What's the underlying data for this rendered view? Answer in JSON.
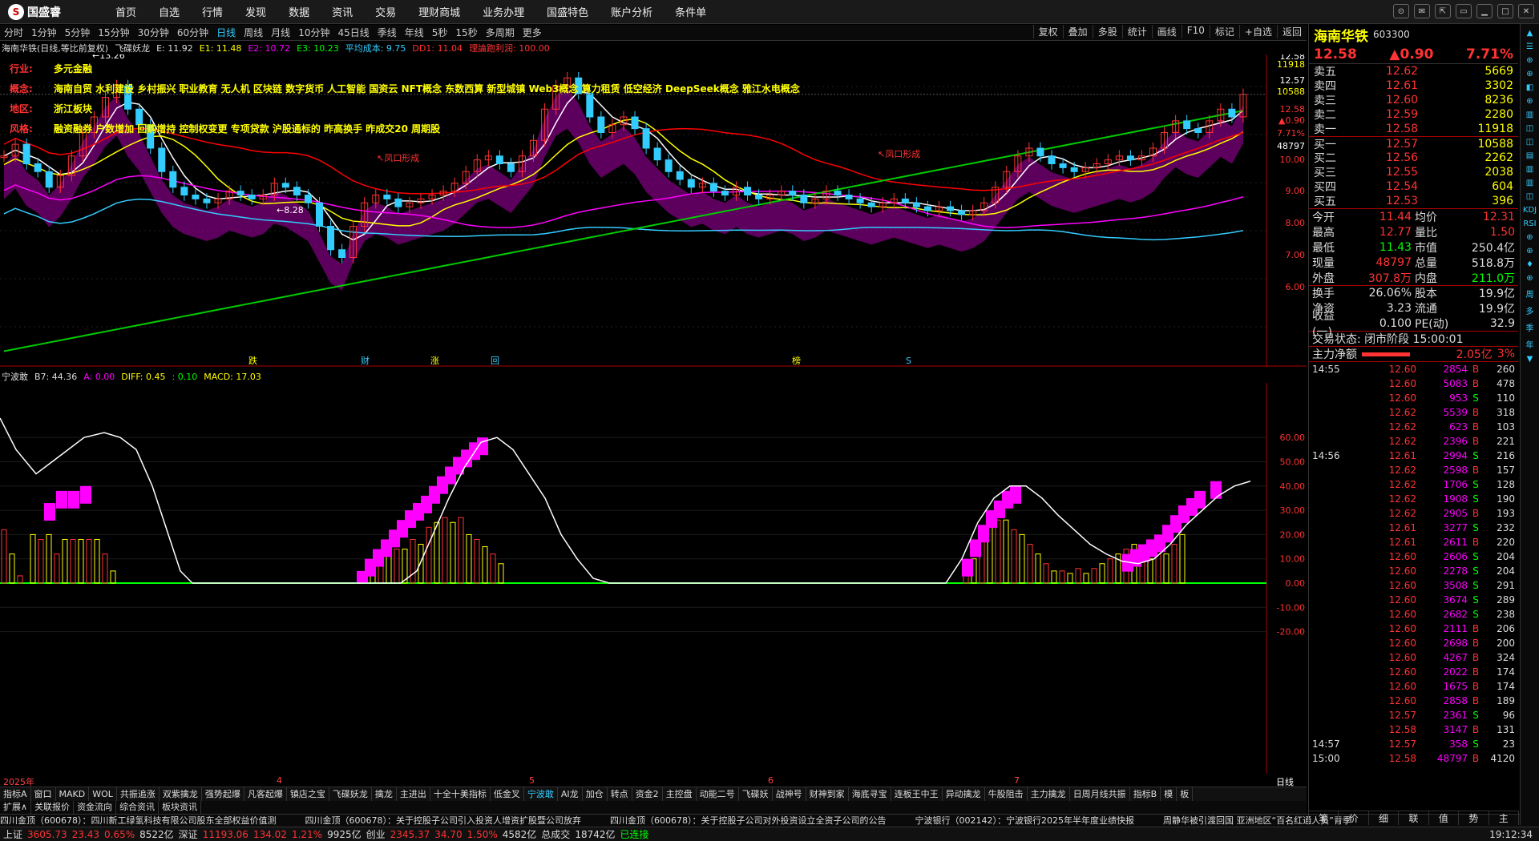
{
  "app": {
    "logo_text": "国盛睿",
    "logo_mark": "S"
  },
  "menu": [
    "首页",
    "自选",
    "行情",
    "发现",
    "数据",
    "资讯",
    "交易",
    "理财商城",
    "业务办理",
    "国盛特色",
    "账户分析",
    "条件单"
  ],
  "window_controls": [
    "⊙",
    "✉",
    "⇱",
    "▭",
    "▁",
    "□",
    "✕"
  ],
  "timeframes": [
    "分时",
    "1分钟",
    "5分钟",
    "15分钟",
    "30分钟",
    "60分钟",
    "日线",
    "周线",
    "月线",
    "10分钟",
    "45日线",
    "季线",
    "年线",
    "5秒",
    "15秒",
    "多周期",
    "更多"
  ],
  "timeframe_active": "日线",
  "tf_right": [
    "复权",
    "叠加",
    "多股",
    "统计",
    "画线",
    "F10",
    "标记",
    "+自选",
    "返回"
  ],
  "chart_header": {
    "title": "海南华铁(日线,等比前复权)",
    "indicator": "飞碟妖龙",
    "e": "E: 11.92",
    "e1": "E1: 11.48",
    "e2": "E2: 10.72",
    "e3": "E3: 10.23",
    "avg_cost": "平均成本: 9.75",
    "dd1": "DD1: 11.04",
    "profit": "理論跑利润: 100.00"
  },
  "info": {
    "industry_k": "行业:",
    "industry_v": "多元金融",
    "concept_k": "概念:",
    "concept_v": "海南自贸 水利建设 乡村振兴 职业教育 无人机 区块链 数字货币 人工智能 国资云 NFT概念 东数西算 新型城镇 Web3概念 算力租赁 低空经济 DeepSeek概念 雅江水电概念",
    "region_k": "地区:",
    "region_v": "浙江板块",
    "style_k": "风格:",
    "style_v": "融资融券 户数增加 回购增持 控制权变更 专项贷款 沪股通标的 昨高换手 昨成交20 周期股"
  },
  "annotations": {
    "high": "13.26",
    "low": "8.28",
    "wind1": "凤口形成",
    "wind2": "凤口形成",
    "price_line": "12.58"
  },
  "markers": [
    "跌",
    "财",
    "涨",
    "回",
    "榜",
    "S"
  ],
  "price_axis": [
    "12.58",
    "11918",
    "12.57",
    "10588",
    "12.58",
    "▲0.90",
    "7.71%",
    "48797",
    "10.00",
    "9.00",
    "8.00",
    "7.00",
    "6.00"
  ],
  "chart_data": [
    {
      "type": "candlestick",
      "title": "海南华铁(日线,等比前复权)",
      "y_ticks": [
        6.0,
        7.0,
        8.0,
        9.0,
        10.0,
        12.58
      ],
      "high": 13.26,
      "low": 8.28,
      "last": 12.58,
      "x_ticks": [
        "2025年",
        "4",
        "5",
        "6",
        "7"
      ],
      "closes": [
        11.0,
        11.3,
        10.8,
        10.6,
        10.2,
        10.5,
        11.0,
        11.6,
        12.0,
        12.5,
        12.8,
        12.2,
        11.8,
        11.2,
        10.6,
        10.2,
        10.0,
        9.9,
        9.8,
        9.9,
        10.1,
        10.0,
        9.9,
        10.0,
        10.3,
        10.2,
        10.0,
        9.8,
        9.2,
        8.6,
        8.4,
        9.2,
        9.8,
        10.0,
        9.9,
        9.7,
        9.8,
        9.9,
        10.0,
        10.1,
        10.3,
        10.6,
        10.9,
        11.0,
        10.8,
        10.6,
        11.0,
        11.4,
        12.2,
        12.8,
        13.0,
        12.6,
        12.0,
        11.6,
        11.8,
        12.0,
        11.7,
        11.2,
        10.9,
        10.6,
        10.4,
        10.2,
        10.3,
        10.1,
        10.0,
        10.2,
        10.0,
        9.9,
        10.0,
        10.1,
        10.0,
        9.8,
        9.9,
        10.1,
        10.0,
        9.9,
        9.8,
        9.7,
        9.8,
        9.9,
        9.8,
        9.7,
        9.6,
        9.7,
        9.6,
        9.5,
        9.6,
        9.8,
        10.2,
        10.6,
        11.0,
        11.2,
        11.0,
        10.8,
        10.7,
        10.6,
        10.7,
        10.8,
        10.9,
        11.0,
        10.9,
        11.0,
        11.2,
        11.6,
        11.9,
        11.7,
        11.6,
        11.9,
        12.2,
        12.0,
        12.58
      ]
    },
    {
      "type": "bar+line",
      "title": "宁波敢",
      "series": [
        {
          "name": "B7",
          "last": 44.36
        },
        {
          "name": "A",
          "last": 0.0
        },
        {
          "name": "DIFF",
          "last": 0.45
        },
        {
          "name": "",
          "last": 0.1
        },
        {
          "name": "MACD",
          "last": 17.03
        }
      ],
      "y_ticks": [
        60.0,
        50.0,
        40.0,
        30.0,
        20.0,
        10.0,
        0.0,
        -10.0,
        -20.0
      ],
      "ylim": [
        -20,
        70
      ]
    }
  ],
  "ind_header": {
    "name": "宁波敢",
    "b7": "B7: 44.36",
    "a": "A: 0.00",
    "diff": "DIFF: 0.45",
    "x": ": 0.10",
    "macd": "MACD: 17.03"
  },
  "ind_axis": [
    "60.00",
    "50.00",
    "40.00",
    "30.00",
    "20.00",
    "10.00",
    "0.00",
    "-10.00",
    "-20.00"
  ],
  "xaxis": [
    "2025年",
    "4",
    "5",
    "6",
    "7"
  ],
  "xaxis_right": "日线",
  "indicator_tabs": [
    "指标A",
    "窗口",
    "MAKD",
    "WOL",
    "共振追涨",
    "双紫擒龙",
    "强势起爆",
    "凡客起爆",
    "镇店之宝",
    "飞碟妖龙",
    "擒龙",
    "主进出",
    "十全十美指标",
    "低金叉",
    "宁波敢",
    "AI龙",
    "加仓",
    "转点",
    "资金2",
    "主控盘",
    "动能二号",
    "飞碟妖",
    "战神号",
    "财神到家",
    "海底寻宝",
    "连板王中王",
    "异动擒龙",
    "牛股阻击",
    "主力擒龙",
    "日周月线共振",
    "指标B",
    "模",
    "板"
  ],
  "indicator_tab_active": "宁波敢",
  "sub_tabs": [
    "扩展∧",
    "关联报价",
    "资金流向",
    "综合资讯",
    "板块资讯"
  ],
  "news": [
    "四川金顶（600678）：四川新工绿氢科技有限公司股东全部权益价值测",
    "四川金顶（600678）：关于控股子公司引入投资人增资扩股暨公司放弃",
    "四川金顶（600678）：关于控股子公司对外投资设立全资子公司的公告",
    "宁波银行（002142）：宁波银行2025年半年度业绩快报",
    "周静华被引渡回国 亚洲地区“百名红通人员”青季"
  ],
  "status": {
    "sh_label": "上证",
    "sh": "3605.73",
    "sh_chg": "23.43",
    "sh_pct": "0.65%",
    "sh_amt": "8522亿",
    "sz_label": "深证",
    "sz": "11193.06",
    "sz_chg": "134.02",
    "sz_pct": "1.21%",
    "sz_amt": "9925亿",
    "cy_label": "创业",
    "cy": "2345.37",
    "cy_chg": "34.70",
    "cy_pct": "1.50%",
    "cy_amt": "4582亿",
    "total_label": "总成交",
    "total": "18742亿",
    "conn": "已连接",
    "time": "19:12:34"
  },
  "stock": {
    "name": "海南华铁",
    "code": "603300",
    "price": "12.58",
    "chg": "▲0.90",
    "pct": "7.71%"
  },
  "orderbook": [
    {
      "l": "卖五",
      "p": "12.62",
      "v": "5669"
    },
    {
      "l": "卖四",
      "p": "12.61",
      "v": "3302"
    },
    {
      "l": "卖三",
      "p": "12.60",
      "v": "8236"
    },
    {
      "l": "卖二",
      "p": "12.59",
      "v": "2280"
    },
    {
      "l": "卖一",
      "p": "12.58",
      "v": "11918"
    },
    {
      "l": "买一",
      "p": "12.57",
      "v": "10588"
    },
    {
      "l": "买二",
      "p": "12.56",
      "v": "2262"
    },
    {
      "l": "买三",
      "p": "12.55",
      "v": "2038"
    },
    {
      "l": "买四",
      "p": "12.54",
      "v": "604"
    },
    {
      "l": "买五",
      "p": "12.53",
      "v": "396"
    }
  ],
  "stats": [
    {
      "a": "今开",
      "b": "11.44",
      "c": "均价",
      "d": "12.31"
    },
    {
      "a": "最高",
      "b": "12.77",
      "c": "量比",
      "d": "1.50"
    },
    {
      "a": "最低",
      "b": "11.43",
      "c": "市值",
      "d": "250.4亿"
    },
    {
      "a": "现量",
      "b": "48797",
      "c": "总量",
      "d": "518.8万"
    },
    {
      "a": "外盘",
      "b": "307.8万",
      "c": "内盘",
      "d": "211.0万"
    },
    {
      "a": "换手",
      "b": "26.06%",
      "c": "股本",
      "d": "19.9亿"
    },
    {
      "a": "净资",
      "b": "3.23",
      "c": "流通",
      "d": "19.9亿"
    },
    {
      "a": "收益(一)",
      "b": "0.100",
      "c": "PE(动)",
      "d": "32.9"
    }
  ],
  "trade_state": "交易状态: 闭市阶段 15:00:01",
  "main_flow": {
    "label": "主力净额",
    "value": "2.05亿",
    "pct": "3%"
  },
  "ticks": [
    {
      "t": "14:55",
      "p": "12.60",
      "v": "2854",
      "f": "B",
      "n": "260"
    },
    {
      "t": "",
      "p": "12.60",
      "v": "5083",
      "f": "B",
      "n": "478"
    },
    {
      "t": "",
      "p": "12.60",
      "v": "953",
      "f": "S",
      "n": "110"
    },
    {
      "t": "",
      "p": "12.62",
      "v": "5539",
      "f": "B",
      "n": "318"
    },
    {
      "t": "",
      "p": "12.62",
      "v": "623",
      "f": "B",
      "n": "103"
    },
    {
      "t": "",
      "p": "12.62",
      "v": "2396",
      "f": "B",
      "n": "221"
    },
    {
      "t": "14:56",
      "p": "12.61",
      "v": "2994",
      "f": "S",
      "n": "216"
    },
    {
      "t": "",
      "p": "12.62",
      "v": "2598",
      "f": "B",
      "n": "157"
    },
    {
      "t": "",
      "p": "12.62",
      "v": "1706",
      "f": "S",
      "n": "128"
    },
    {
      "t": "",
      "p": "12.62",
      "v": "1908",
      "f": "S",
      "n": "190"
    },
    {
      "t": "",
      "p": "12.62",
      "v": "2905",
      "f": "B",
      "n": "193"
    },
    {
      "t": "",
      "p": "12.61",
      "v": "3277",
      "f": "S",
      "n": "232"
    },
    {
      "t": "",
      "p": "12.61",
      "v": "2611",
      "f": "B",
      "n": "220"
    },
    {
      "t": "",
      "p": "12.60",
      "v": "2606",
      "f": "S",
      "n": "204"
    },
    {
      "t": "",
      "p": "12.60",
      "v": "2278",
      "f": "S",
      "n": "204"
    },
    {
      "t": "",
      "p": "12.60",
      "v": "3508",
      "f": "S",
      "n": "291"
    },
    {
      "t": "",
      "p": "12.60",
      "v": "3674",
      "f": "S",
      "n": "289"
    },
    {
      "t": "",
      "p": "12.60",
      "v": "2682",
      "f": "S",
      "n": "238"
    },
    {
      "t": "",
      "p": "12.60",
      "v": "2111",
      "f": "B",
      "n": "206"
    },
    {
      "t": "",
      "p": "12.60",
      "v": "2698",
      "f": "B",
      "n": "200"
    },
    {
      "t": "",
      "p": "12.60",
      "v": "4267",
      "f": "B",
      "n": "324"
    },
    {
      "t": "",
      "p": "12.60",
      "v": "2022",
      "f": "B",
      "n": "174"
    },
    {
      "t": "",
      "p": "12.60",
      "v": "1675",
      "f": "B",
      "n": "174"
    },
    {
      "t": "",
      "p": "12.60",
      "v": "2858",
      "f": "B",
      "n": "189"
    },
    {
      "t": "",
      "p": "12.57",
      "v": "2361",
      "f": "S",
      "n": "96"
    },
    {
      "t": "",
      "p": "12.58",
      "v": "3147",
      "f": "B",
      "n": "131"
    },
    {
      "t": "14:57",
      "p": "12.57",
      "v": "358",
      "f": "S",
      "n": "23"
    },
    {
      "t": "15:00",
      "p": "12.58",
      "v": "48797",
      "f": "B",
      "n": "4120"
    }
  ],
  "right_bottom": [
    "笔",
    "价",
    "细",
    "联",
    "值",
    "势",
    "主"
  ],
  "right_side": [
    "▲",
    "☰",
    "⊕",
    "⊕",
    "◧",
    "⊕",
    "▥",
    "◫",
    "◫",
    "▤",
    "▥",
    "▥",
    "◫",
    "KDJ",
    "RSI",
    "⊕",
    "⊕",
    "♦",
    "⊕",
    "周",
    "多",
    "季",
    "年",
    "▼"
  ]
}
